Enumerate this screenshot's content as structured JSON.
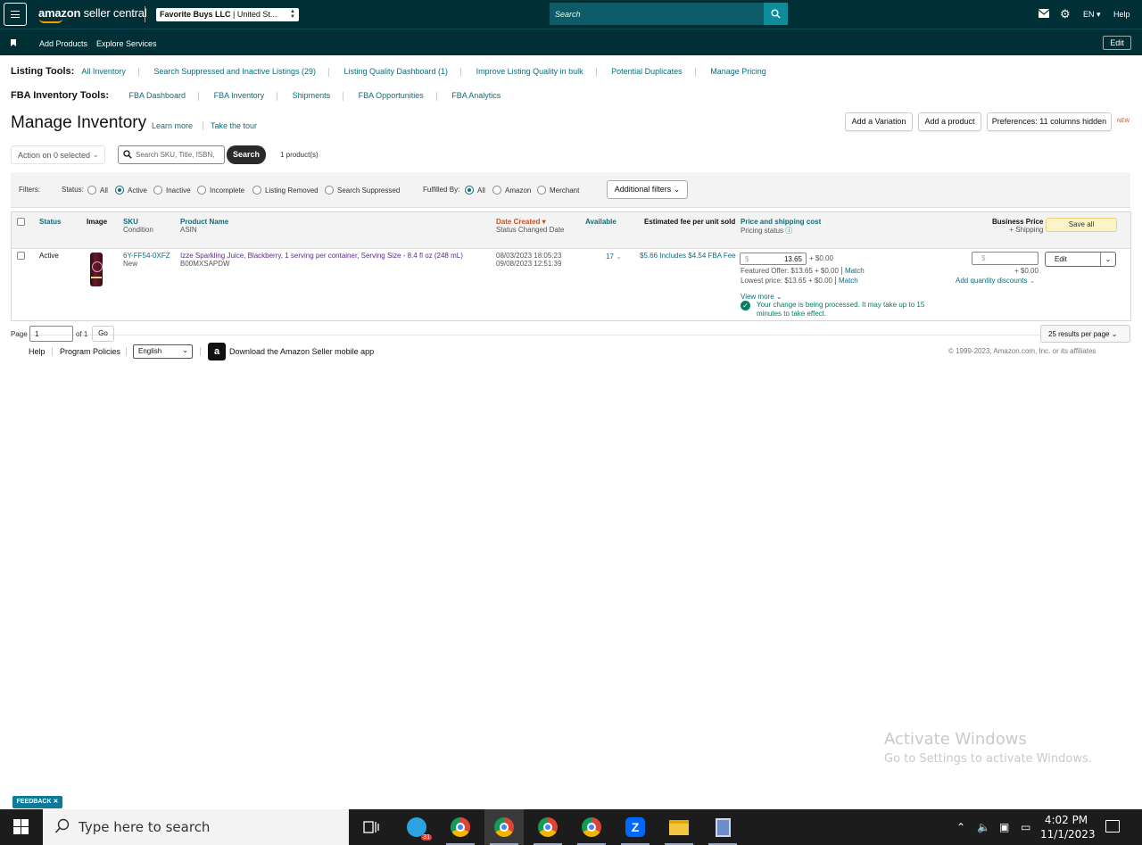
{
  "topbar": {
    "logo_prefix": "amazon",
    "logo_suffix": "seller central",
    "store_name": "Favorite Buys LLC",
    "store_region": "United St...",
    "search_placeholder": "Search",
    "language": "EN",
    "help": "Help"
  },
  "subbar": {
    "items": [
      "Add Products",
      "Explore Services"
    ],
    "edit": "Edit"
  },
  "listing_tools": {
    "title": "Listing Tools:",
    "links": [
      "All Inventory",
      "Search Suppressed and Inactive Listings (29)",
      "Listing Quality Dashboard (1)",
      "Improve Listing Quality in bulk",
      "Potential Duplicates",
      "Manage Pricing"
    ]
  },
  "fba_tools": {
    "title": "FBA Inventory Tools:",
    "links": [
      "FBA Dashboard",
      "FBA Inventory",
      "Shipments",
      "FBA Opportunities",
      "FBA Analytics"
    ]
  },
  "page": {
    "title": "Manage Inventory",
    "learn_more": "Learn more",
    "take_tour": "Take the tour",
    "add_variation": "Add a Variation",
    "add_product": "Add a product",
    "preferences": "Preferences: 11 columns hidden",
    "new_tag": "NEW"
  },
  "controls": {
    "action": "Action on 0 selected",
    "search_placeholder": "Search SKU, Title, ISBN,",
    "search_button": "Search",
    "product_count": "1 product(s)"
  },
  "filters": {
    "label": "Filters:",
    "status_label": "Status:",
    "status_options": [
      "All",
      "Active",
      "Inactive",
      "Incomplete",
      "Listing Removed",
      "Search Suppressed"
    ],
    "status_selected": "Active",
    "fulfilled_label": "Fulfilled By:",
    "fulfilled_options": [
      "All",
      "Amazon",
      "Merchant"
    ],
    "fulfilled_selected": "All",
    "additional": "Additional filters"
  },
  "table": {
    "headers": {
      "status": "Status",
      "image": "Image",
      "sku": "SKU",
      "sku_sub": "Condition",
      "product_name": "Product Name",
      "product_sub": "ASIN",
      "date_created": "Date Created",
      "date_sub": "Status Changed Date",
      "available": "Available",
      "fee": "Estimated fee per unit sold",
      "price": "Price and shipping cost",
      "price_sub": "Pricing status",
      "business": "Business Price",
      "business_sub": "+ Shipping",
      "save_all": "Save all"
    },
    "rows": [
      {
        "status": "Active",
        "sku": "6Y-FF54-0XFZ",
        "condition": "New",
        "product_name": "Izze Sparkling Juice, Blackberry, 1 serving per container, Serving Size - 8.4 fl oz (248 mL)",
        "asin": "B00MXSAPDW",
        "date_created": "08/03/2023 18:05:23",
        "status_changed": "09/08/2023 12:51:39",
        "available": "17",
        "fee": "$5.66 Includes $4.54 FBA Fee",
        "currency": "$",
        "price": "13.65",
        "shipping": "+ $0.00",
        "featured_offer": "Featured Offer: $13.65 + $0.00",
        "lowest_price": "Lowest price: $13.65 + $0.00",
        "match": "Match",
        "view_more": "View more",
        "processing": "Your change is being processed. It may take up to 15 minutes to take effect.",
        "business_shipping": "+ $0.00",
        "quantity_discounts": "Add quantity discounts",
        "action": "Edit"
      }
    ]
  },
  "pagination": {
    "page_label": "Page",
    "page_value": "1",
    "of": "of 1",
    "go": "Go",
    "per_page": "25 results per page"
  },
  "footer": {
    "help": "Help",
    "policies": "Program Policies",
    "language": "English",
    "app": "Download the Amazon Seller mobile app",
    "copyright": "© 1999-2023, Amazon.com, Inc. or its affiliates"
  },
  "watermark": {
    "line1": "Activate Windows",
    "line2": "Go to Settings to activate Windows."
  },
  "feedback": "FEEDBACK ✕",
  "taskbar": {
    "search_placeholder": "Type here to search",
    "time": "4:02 PM",
    "date": "11/1/2023",
    "badge": "31"
  }
}
